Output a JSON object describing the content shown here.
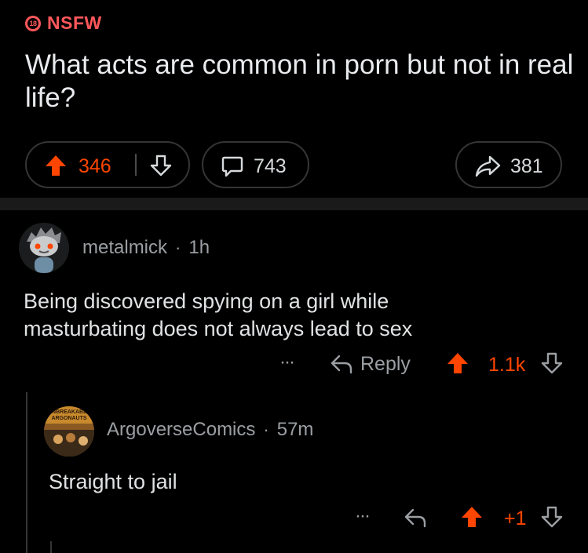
{
  "post": {
    "nsfw_badge": "18",
    "nsfw_label": "NSFW",
    "title": "What acts are common in porn but not in real life?",
    "upvotes": "346",
    "comments": "743",
    "shares": "381"
  },
  "comments": [
    {
      "author": "metalmick",
      "separator": "·",
      "age": "1h",
      "body": "Being discovered spying on a girl while masturbating does not always lead to sex",
      "more": "···",
      "reply_label": "Reply",
      "score": "1.1k",
      "avatar_icon": "snoo-avatar-icon"
    },
    {
      "author": "ArgoverseComics",
      "separator": "·",
      "age": "57m",
      "body": "Straight to jail",
      "more": "···",
      "score": "+1",
      "avatar_text": "UNBREAKABLE ARGONAUTS"
    }
  ],
  "colors": {
    "accent": "#ff4500",
    "nsfw": "#ff585b",
    "background": "#000000",
    "muted_text": "#9b9fa3"
  }
}
